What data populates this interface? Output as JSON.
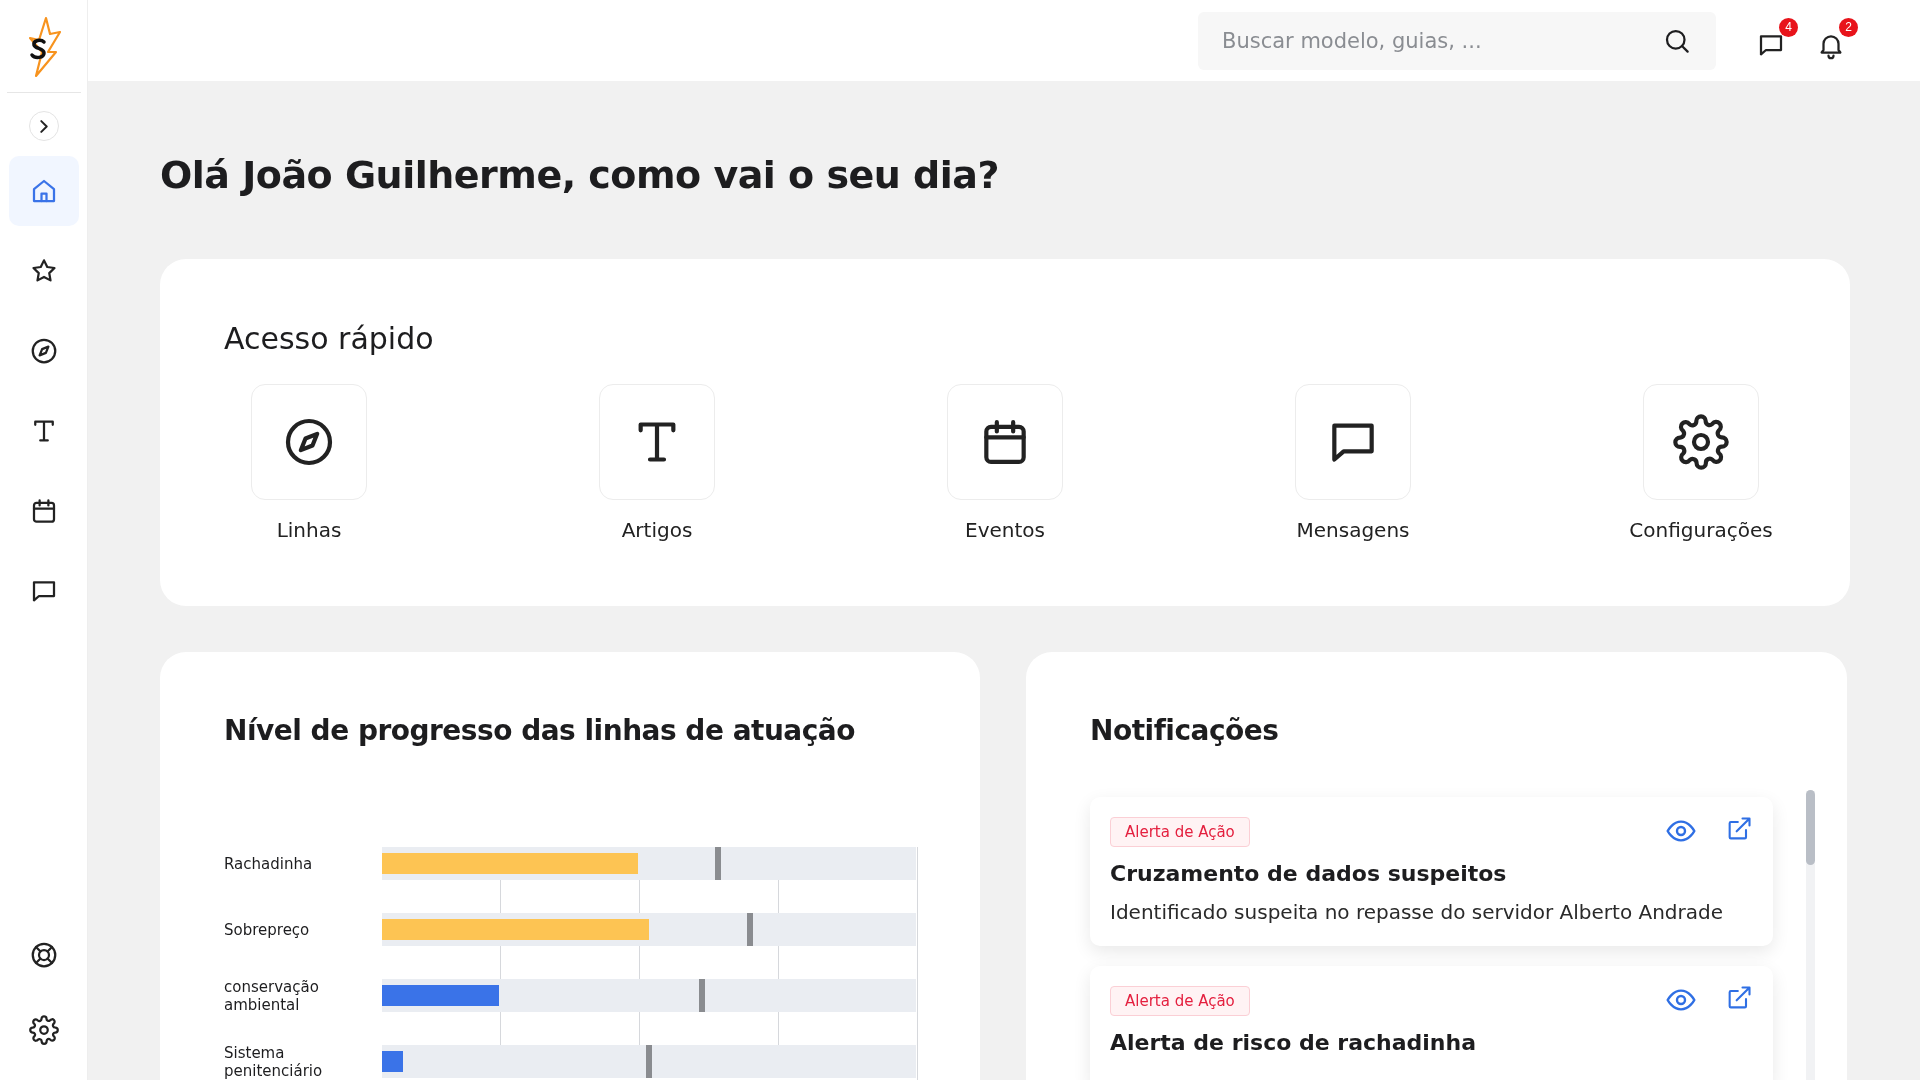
{
  "header": {
    "search": {
      "placeholder": "Buscar modelo, guias, ..."
    },
    "message_badge": "4",
    "notification_badge": "2"
  },
  "sidebar": {
    "items": [
      {
        "selected": true
      },
      {
        "selected": false
      },
      {
        "selected": false
      },
      {
        "selected": false
      },
      {
        "selected": false
      },
      {
        "selected": false
      }
    ],
    "bottom_items": [
      {
        "selected": false
      },
      {
        "selected": false
      }
    ]
  },
  "greeting": "Olá João Guilherme, como vai o seu dia?",
  "quick_access": {
    "title": "Acesso rápido",
    "items": [
      {
        "label": "Linhas"
      },
      {
        "label": "Artigos"
      },
      {
        "label": "Eventos"
      },
      {
        "label": "Mensagens"
      },
      {
        "label": "Configurações"
      }
    ]
  },
  "progress": {
    "title": "Nível de progresso das linhas de atuação",
    "rows": [
      {
        "label": "Rachadinha",
        "level": 0.48,
        "color": "#fdc453",
        "target": {
          "level": 0.63
        }
      },
      {
        "label": "Sobrepreço",
        "level": 0.5,
        "color": "#fdc453",
        "target": {
          "level": 0.69
        }
      },
      {
        "label": "conservação ambiental",
        "level": 0.22,
        "color": "#3a73e8",
        "target": {
          "level": 0.6
        }
      },
      {
        "label": "Sistema penitenciário",
        "level": 0.04,
        "color": "#3a73e8",
        "target": {
          "level": 0.5
        }
      }
    ]
  },
  "notifications": {
    "title": "Notificações",
    "items": [
      {
        "tag": "Alerta de Ação",
        "title": "Cruzamento de dados suspeitos",
        "description": "Identificado suspeita no repasse do servidor Alberto Andrade"
      },
      {
        "tag": "Alerta de Ação",
        "title": "Alerta de risco de rachadinha"
      }
    ]
  }
}
